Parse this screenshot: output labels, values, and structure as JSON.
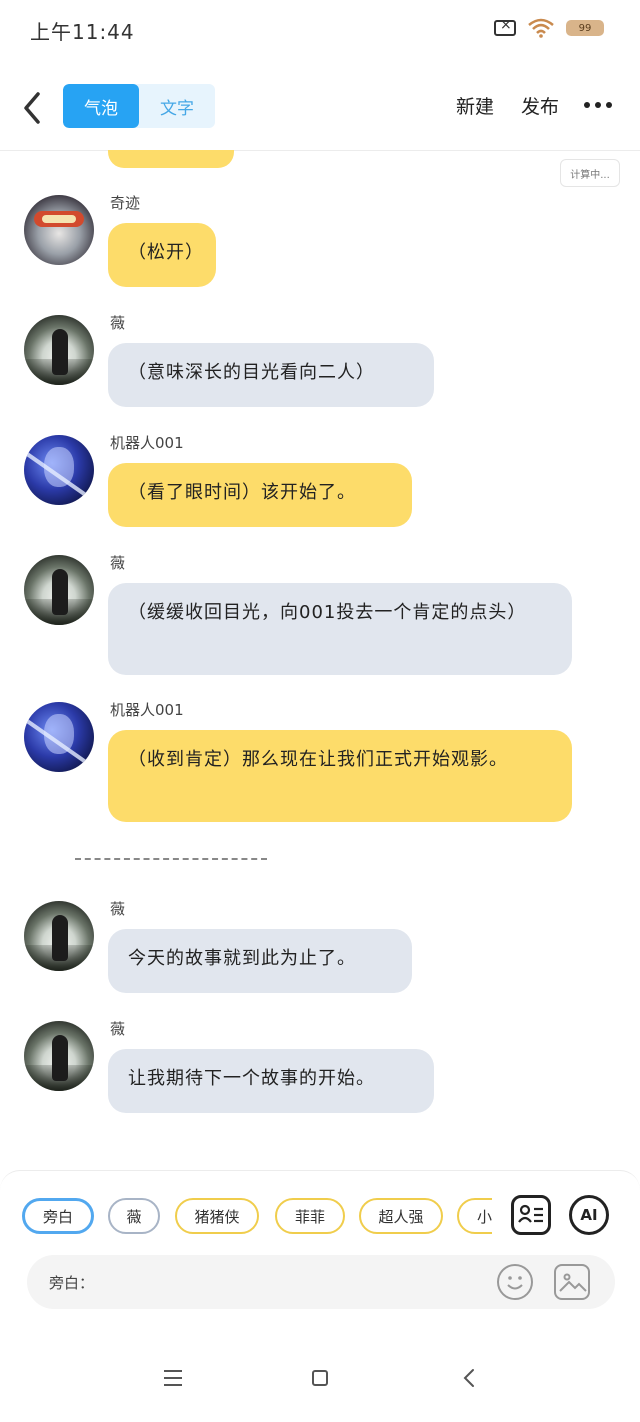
{
  "status_bar": {
    "time": "上午11:44",
    "battery": "99"
  },
  "header": {
    "tabs": [
      {
        "label": "气泡",
        "active": true
      },
      {
        "label": "文字",
        "active": false
      }
    ],
    "new_label": "新建",
    "publish_label": "发布"
  },
  "chat": {
    "calc_badge": "计算中...",
    "messages": [
      {
        "sender": "奇迹",
        "text": "（松开）",
        "color": "yellow",
        "avatar": "hero-avatar"
      },
      {
        "sender": "薇",
        "text": "（意味深长的目光看向二人）",
        "color": "gray",
        "avatar": "night-avatar"
      },
      {
        "sender": "机器人001",
        "text": "（看了眼时间）该开始了。",
        "color": "yellow",
        "avatar": "robot-avatar"
      },
      {
        "sender": "薇",
        "text": "（缓缓收回目光，向001投去一个肯定的点头）",
        "color": "gray",
        "avatar": "night-avatar"
      },
      {
        "sender": "机器人001",
        "text": "（收到肯定）那么现在让我们正式开始观影。",
        "color": "yellow",
        "avatar": "robot-avatar"
      },
      {
        "sender": "薇",
        "text": "今天的故事就到此为止了。",
        "color": "gray",
        "avatar": "night-avatar"
      },
      {
        "sender": "薇",
        "text": "让我期待下一个故事的开始。",
        "color": "gray",
        "avatar": "night-avatar"
      }
    ]
  },
  "role_chips": [
    {
      "label": "旁白",
      "style": "narr"
    },
    {
      "label": "薇",
      "style": "gray"
    },
    {
      "label": "猪猪侠",
      "style": "yellow"
    },
    {
      "label": "菲菲",
      "style": "yellow"
    },
    {
      "label": "超人强",
      "style": "yellow"
    },
    {
      "label": "小",
      "style": "yellow"
    }
  ],
  "ai_label": "AI",
  "input": {
    "label": "旁白：",
    "value": ""
  },
  "colors": {
    "accent": "#27a3f3",
    "bubble_yellow": "#fddc6a",
    "bubble_gray": "#e1e6ee"
  }
}
